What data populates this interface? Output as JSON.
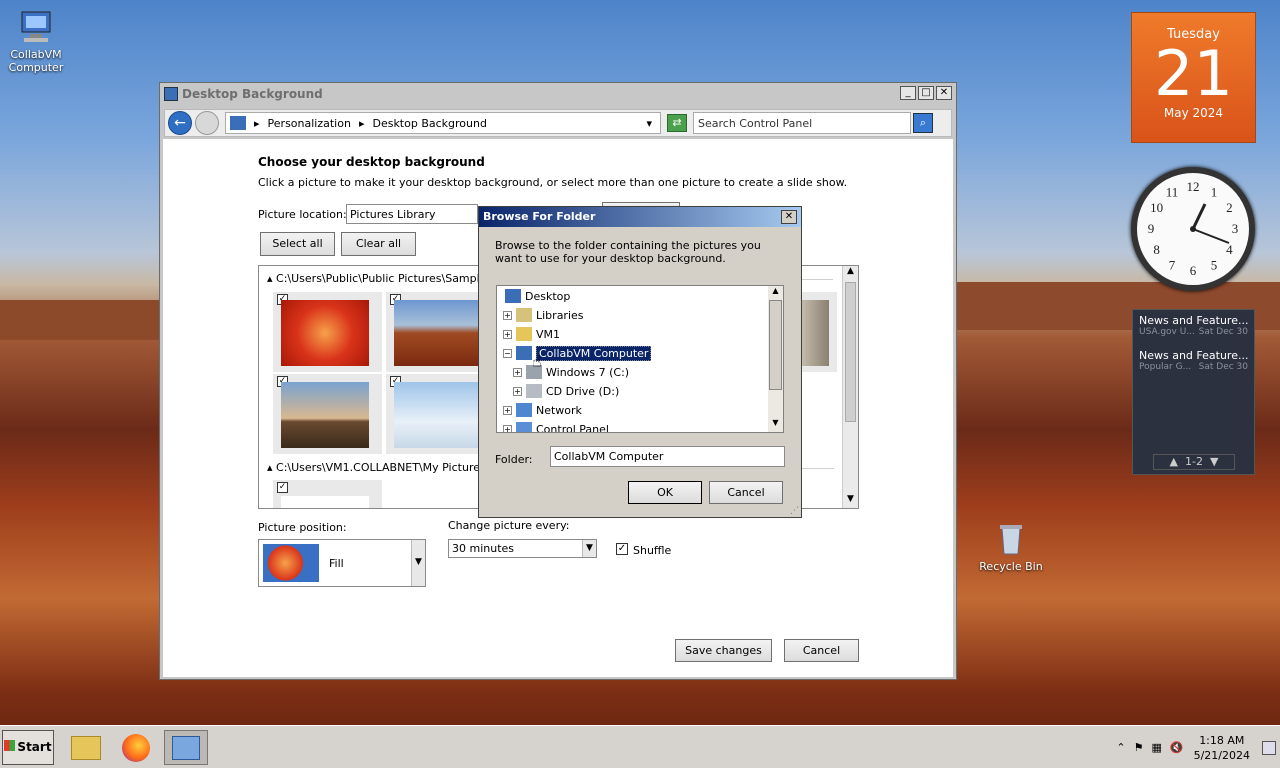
{
  "desktop": {
    "computer_icon_label": "CollabVM Computer",
    "recycle_bin_label": "Recycle Bin"
  },
  "window": {
    "title": "Desktop Background",
    "controls": {
      "minimize": "_",
      "maximize": "□",
      "close": "✕"
    },
    "breadcrumb": [
      "Personalization",
      "Desktop Background"
    ],
    "search_placeholder": "Search Control Panel",
    "heading": "Choose your desktop background",
    "description": "Click a picture to make it your desktop background, or select more than one picture to create a slide show.",
    "picture_location_label": "Picture location:",
    "picture_location_value": "Pictures Library",
    "select_all": "Select all",
    "clear_all": "Clear all",
    "group1_path": "C:\\Users\\Public\\Public Pictures\\Sample Pictu",
    "group2_path": "C:\\Users\\VM1.COLLABNET\\My Pictures (1)",
    "picture_position_label": "Picture position:",
    "picture_position_value": "Fill",
    "change_every_label": "Change picture every:",
    "change_every_value": "30 minutes",
    "shuffle_label": "Shuffle",
    "save_changes": "Save changes",
    "cancel": "Cancel"
  },
  "dialog": {
    "title": "Browse For Folder",
    "instructions": "Browse to the folder containing the pictures you want to use for your desktop background.",
    "tree": [
      {
        "label": "Desktop",
        "expander": ""
      },
      {
        "label": "Libraries",
        "expander": "+"
      },
      {
        "label": "VM1",
        "expander": "+"
      },
      {
        "label": "CollabVM Computer",
        "expander": "−"
      },
      {
        "label": "Windows 7 (C:)",
        "expander": "+"
      },
      {
        "label": "CD Drive (D:)",
        "expander": "+"
      },
      {
        "label": "Network",
        "expander": "+"
      },
      {
        "label": "Control Panel",
        "expander": "+"
      }
    ],
    "folder_label": "Folder:",
    "folder_value": "CollabVM Computer",
    "ok": "OK",
    "cancel": "Cancel"
  },
  "gadgets": {
    "calendar": {
      "weekday": "Tuesday",
      "day": "21",
      "month_year": "May 2024"
    },
    "clock_numbers": [
      "12",
      "1",
      "2",
      "3",
      "4",
      "5",
      "6",
      "7",
      "8",
      "9",
      "10",
      "11"
    ],
    "news": [
      {
        "title": "News and Feature...",
        "source": "USA.gov U...",
        "date": "Sat Dec 30"
      },
      {
        "title": "News and Feature...",
        "source": "Popular G...",
        "date": "Sat Dec 30"
      }
    ],
    "news_pager": "1-2"
  },
  "taskbar": {
    "start_label": "Start",
    "time": "1:18 AM",
    "date": "5/21/2024"
  },
  "colors": {
    "accent": "#0a246a",
    "calendar": "#e8681f"
  }
}
